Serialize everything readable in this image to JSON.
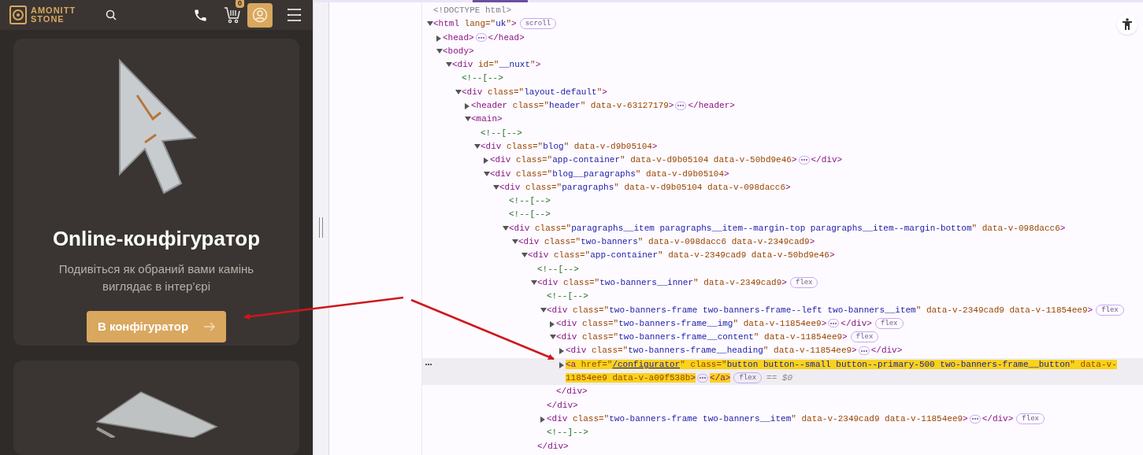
{
  "site": {
    "logo_text": [
      "AMONITT",
      "STONE"
    ],
    "cart_count": "0",
    "card": {
      "title": "Online-конфігуратор",
      "description": "Подивіться як обраний вами камінь виглядає в інтер’єрі",
      "button": "В конфігуратор"
    }
  },
  "elements_tree": [
    {
      "tokens": [
        {
          "kind": "d",
          "text": "<!DOCTYPE html>"
        }
      ],
      "selected": false
    },
    {
      "tokens": [
        {
          "kind": "t",
          "text": "<html"
        },
        {
          "kind": "a",
          "text": " lang=\""
        },
        {
          "kind": "v",
          "text": "uk"
        },
        {
          "kind": "a",
          "text": "\""
        },
        {
          "kind": "t",
          "text": ">"
        },
        {
          "kind": "b",
          "text": "scroll"
        }
      ],
      "expanded": true,
      "selected": false,
      "children": [
        {
          "tokens": [
            {
              "kind": "t",
              "text": "<head>"
            },
            {
              "kind": "m"
            },
            {
              "kind": "t",
              "text": "</head>"
            }
          ],
          "expanded": false,
          "selected": false
        },
        {
          "tokens": [
            {
              "kind": "t",
              "text": "<body>"
            }
          ],
          "expanded": true,
          "selected": false,
          "children": [
            {
              "tokens": [
                {
                  "kind": "t",
                  "text": "<div"
                },
                {
                  "kind": "a",
                  "text": " id=\""
                },
                {
                  "kind": "v",
                  "text": "__nuxt"
                },
                {
                  "kind": "a",
                  "text": "\""
                },
                {
                  "kind": "t",
                  "text": ">"
                }
              ],
              "expanded": true,
              "selected": false,
              "children": [
                {
                  "tokens": [
                    {
                      "kind": "c",
                      "text": "<!--[-->"
                    }
                  ],
                  "selected": false
                },
                {
                  "tokens": [
                    {
                      "kind": "t",
                      "text": "<div"
                    },
                    {
                      "kind": "a",
                      "text": " class=\""
                    },
                    {
                      "kind": "v",
                      "text": "layout-default"
                    },
                    {
                      "kind": "a",
                      "text": "\""
                    },
                    {
                      "kind": "t",
                      "text": ">"
                    }
                  ],
                  "expanded": true,
                  "selected": false,
                  "children": [
                    {
                      "tokens": [
                        {
                          "kind": "t",
                          "text": "<header"
                        },
                        {
                          "kind": "a",
                          "text": " class=\""
                        },
                        {
                          "kind": "v",
                          "text": "header"
                        },
                        {
                          "kind": "a",
                          "text": "\" data-v-63127179"
                        },
                        {
                          "kind": "t",
                          "text": ">"
                        },
                        {
                          "kind": "m"
                        },
                        {
                          "kind": "t",
                          "text": "</header>"
                        }
                      ],
                      "expanded": false,
                      "selected": false
                    },
                    {
                      "tokens": [
                        {
                          "kind": "t",
                          "text": "<main>"
                        }
                      ],
                      "expanded": true,
                      "selected": false,
                      "children": [
                        {
                          "tokens": [
                            {
                              "kind": "c",
                              "text": "<!--[-->"
                            }
                          ],
                          "selected": false
                        },
                        {
                          "tokens": [
                            {
                              "kind": "t",
                              "text": "<div"
                            },
                            {
                              "kind": "a",
                              "text": " class=\""
                            },
                            {
                              "kind": "v",
                              "text": "blog"
                            },
                            {
                              "kind": "a",
                              "text": "\" data-v-d9b05104"
                            },
                            {
                              "kind": "t",
                              "text": ">"
                            }
                          ],
                          "expanded": true,
                          "selected": false,
                          "children": [
                            {
                              "tokens": [
                                {
                                  "kind": "t",
                                  "text": "<div"
                                },
                                {
                                  "kind": "a",
                                  "text": " class=\""
                                },
                                {
                                  "kind": "v",
                                  "text": "app-container"
                                },
                                {
                                  "kind": "a",
                                  "text": "\" data-v-d9b05104 data-v-50bd9e46"
                                },
                                {
                                  "kind": "t",
                                  "text": ">"
                                },
                                {
                                  "kind": "m"
                                },
                                {
                                  "kind": "t",
                                  "text": "</div>"
                                }
                              ],
                              "expanded": false,
                              "selected": false
                            },
                            {
                              "tokens": [
                                {
                                  "kind": "t",
                                  "text": "<div"
                                },
                                {
                                  "kind": "a",
                                  "text": " class=\""
                                },
                                {
                                  "kind": "v",
                                  "text": "blog__paragraphs"
                                },
                                {
                                  "kind": "a",
                                  "text": "\" data-v-d9b05104"
                                },
                                {
                                  "kind": "t",
                                  "text": ">"
                                }
                              ],
                              "expanded": true,
                              "selected": false,
                              "children": [
                                {
                                  "tokens": [
                                    {
                                      "kind": "t",
                                      "text": "<div"
                                    },
                                    {
                                      "kind": "a",
                                      "text": " class=\""
                                    },
                                    {
                                      "kind": "v",
                                      "text": "paragraphs"
                                    },
                                    {
                                      "kind": "a",
                                      "text": "\" data-v-d9b05104 data-v-098dacc6"
                                    },
                                    {
                                      "kind": "t",
                                      "text": ">"
                                    }
                                  ],
                                  "expanded": true,
                                  "selected": false,
                                  "children": [
                                    {
                                      "tokens": [
                                        {
                                          "kind": "c",
                                          "text": "<!--[-->"
                                        }
                                      ],
                                      "selected": false
                                    },
                                    {
                                      "tokens": [
                                        {
                                          "kind": "c",
                                          "text": "<!--[-->"
                                        }
                                      ],
                                      "selected": false
                                    },
                                    {
                                      "tokens": [
                                        {
                                          "kind": "t",
                                          "text": "<div"
                                        },
                                        {
                                          "kind": "a",
                                          "text": " class=\""
                                        },
                                        {
                                          "kind": "v",
                                          "text": "paragraphs__item paragraphs__item--margin-top paragraphs__item--margin-bottom"
                                        },
                                        {
                                          "kind": "a",
                                          "text": "\" data-v-098dacc6"
                                        },
                                        {
                                          "kind": "t",
                                          "text": ">"
                                        }
                                      ],
                                      "expanded": true,
                                      "selected": false,
                                      "children": [
                                        {
                                          "tokens": [
                                            {
                                              "kind": "t",
                                              "text": "<div"
                                            },
                                            {
                                              "kind": "a",
                                              "text": " class=\""
                                            },
                                            {
                                              "kind": "v",
                                              "text": "two-banners"
                                            },
                                            {
                                              "kind": "a",
                                              "text": "\" data-v-098dacc6 data-v-2349cad9"
                                            },
                                            {
                                              "kind": "t",
                                              "text": ">"
                                            }
                                          ],
                                          "expanded": true,
                                          "selected": false,
                                          "children": [
                                            {
                                              "tokens": [
                                                {
                                                  "kind": "t",
                                                  "text": "<div"
                                                },
                                                {
                                                  "kind": "a",
                                                  "text": " class=\""
                                                },
                                                {
                                                  "kind": "v",
                                                  "text": "app-container"
                                                },
                                                {
                                                  "kind": "a",
                                                  "text": "\" data-v-2349cad9 data-v-50bd9e46"
                                                },
                                                {
                                                  "kind": "t",
                                                  "text": ">"
                                                }
                                              ],
                                              "expanded": true,
                                              "selected": false,
                                              "children": [
                                                {
                                                  "tokens": [
                                                    {
                                                      "kind": "c",
                                                      "text": "<!--[-->"
                                                    }
                                                  ],
                                                  "selected": false
                                                },
                                                {
                                                  "tokens": [
                                                    {
                                                      "kind": "t",
                                                      "text": "<div"
                                                    },
                                                    {
                                                      "kind": "a",
                                                      "text": " class=\""
                                                    },
                                                    {
                                                      "kind": "v",
                                                      "text": "two-banners__inner"
                                                    },
                                                    {
                                                      "kind": "a",
                                                      "text": "\" data-v-2349cad9"
                                                    },
                                                    {
                                                      "kind": "t",
                                                      "text": ">"
                                                    },
                                                    {
                                                      "kind": "b",
                                                      "text": "flex"
                                                    }
                                                  ],
                                                  "expanded": true,
                                                  "selected": false,
                                                  "closing": [
                                                    {
                                                      "kind": "t",
                                                      "text": "</div>"
                                                    }
                                                  ],
                                                  "children": [
                                                    {
                                                      "tokens": [
                                                        {
                                                          "kind": "c",
                                                          "text": "<!--[-->"
                                                        }
                                                      ],
                                                      "selected": false
                                                    },
                                                    {
                                                      "tokens": [
                                                        {
                                                          "kind": "t",
                                                          "text": "<div"
                                                        },
                                                        {
                                                          "kind": "a",
                                                          "text": " class=\""
                                                        },
                                                        {
                                                          "kind": "v",
                                                          "text": "two-banners-frame two-banners-frame--left two-banners__item"
                                                        },
                                                        {
                                                          "kind": "a",
                                                          "text": "\" data-v-2349cad9 data-v-11854ee9"
                                                        },
                                                        {
                                                          "kind": "t",
                                                          "text": ">"
                                                        },
                                                        {
                                                          "kind": "b",
                                                          "text": "flex"
                                                        }
                                                      ],
                                                      "expanded": true,
                                                      "selected": false,
                                                      "closing": [
                                                        {
                                                          "kind": "t",
                                                          "text": "</div>"
                                                        }
                                                      ],
                                                      "children": [
                                                        {
                                                          "tokens": [
                                                            {
                                                              "kind": "t",
                                                              "text": "<div"
                                                            },
                                                            {
                                                              "kind": "a",
                                                              "text": " class=\""
                                                            },
                                                            {
                                                              "kind": "v",
                                                              "text": "two-banners-frame__img"
                                                            },
                                                            {
                                                              "kind": "a",
                                                              "text": "\" data-v-11854ee9"
                                                            },
                                                            {
                                                              "kind": "t",
                                                              "text": ">"
                                                            },
                                                            {
                                                              "kind": "m"
                                                            },
                                                            {
                                                              "kind": "t",
                                                              "text": "</div>"
                                                            },
                                                            {
                                                              "kind": "b",
                                                              "text": "flex"
                                                            }
                                                          ],
                                                          "expanded": false,
                                                          "selected": false
                                                        },
                                                        {
                                                          "tokens": [
                                                            {
                                                              "kind": "t",
                                                              "text": "<div"
                                                            },
                                                            {
                                                              "kind": "a",
                                                              "text": " class=\""
                                                            },
                                                            {
                                                              "kind": "v",
                                                              "text": "two-banners-frame__content"
                                                            },
                                                            {
                                                              "kind": "a",
                                                              "text": "\" data-v-11854ee9"
                                                            },
                                                            {
                                                              "kind": "t",
                                                              "text": ">"
                                                            },
                                                            {
                                                              "kind": "b",
                                                              "text": "flex"
                                                            }
                                                          ],
                                                          "expanded": true,
                                                          "selected": false,
                                                          "closing": [
                                                            {
                                                              "kind": "t",
                                                              "text": "</div>"
                                                            }
                                                          ],
                                                          "children": [
                                                            {
                                                              "tokens": [
                                                                {
                                                                  "kind": "t",
                                                                  "text": "<div"
                                                                },
                                                                {
                                                                  "kind": "a",
                                                                  "text": " class=\""
                                                                },
                                                                {
                                                                  "kind": "v",
                                                                  "text": "two-banners-frame__heading"
                                                                },
                                                                {
                                                                  "kind": "a",
                                                                  "text": "\" data-v-11854ee9"
                                                                },
                                                                {
                                                                  "kind": "t",
                                                                  "text": ">"
                                                                },
                                                                {
                                                                  "kind": "m"
                                                                },
                                                                {
                                                                  "kind": "t",
                                                                  "text": "</div>"
                                                                }
                                                              ],
                                                              "expanded": false,
                                                              "selected": false
                                                            },
                                                            {
                                                              "tokens": [
                                                                {
                                                                  "kind": "t",
                                                                  "text": "<a"
                                                                },
                                                                {
                                                                  "kind": "a",
                                                                  "text": " href=\""
                                                                },
                                                                {
                                                                  "kind": "l",
                                                                  "text": "/configurator"
                                                                },
                                                                {
                                                                  "kind": "a",
                                                                  "text": "\" class=\""
                                                                },
                                                                {
                                                                  "kind": "v",
                                                                  "text": "button button--small button--primary-500 two-banners-frame__button"
                                                                },
                                                                {
                                                                  "kind": "a",
                                                                  "text": "\" data-v-11854ee9 data-v-a09f538b"
                                                                },
                                                                {
                                                                  "kind": "t",
                                                                  "text": ">"
                                                                },
                                                                {
                                                                  "kind": "m"
                                                                },
                                                                {
                                                                  "kind": "t",
                                                                  "text": "</a>"
                                                                },
                                                                {
                                                                  "kind": "b",
                                                                  "text": "flex"
                                                                },
                                                                {
                                                                  "kind": "h",
                                                                  "text": "== $0"
                                                                }
                                                              ],
                                                              "expanded": false,
                                                              "selected": true
                                                            }
                                                          ]
                                                        }
                                                      ]
                                                    },
                                                    {
                                                      "tokens": [
                                                        {
                                                          "kind": "t",
                                                          "text": "<div"
                                                        },
                                                        {
                                                          "kind": "a",
                                                          "text": " class=\""
                                                        },
                                                        {
                                                          "kind": "v",
                                                          "text": "two-banners-frame two-banners__item"
                                                        },
                                                        {
                                                          "kind": "a",
                                                          "text": "\" data-v-2349cad9 data-v-11854ee9"
                                                        },
                                                        {
                                                          "kind": "t",
                                                          "text": ">"
                                                        },
                                                        {
                                                          "kind": "m"
                                                        },
                                                        {
                                                          "kind": "t",
                                                          "text": "</div>"
                                                        },
                                                        {
                                                          "kind": "b",
                                                          "text": "flex"
                                                        }
                                                      ],
                                                      "expanded": false,
                                                      "selected": false
                                                    },
                                                    {
                                                      "tokens": [
                                                        {
                                                          "kind": "c",
                                                          "text": "<!--]-->"
                                                        }
                                                      ],
                                                      "selected": false
                                                    }
                                                  ]
                                                }
                                              ]
                                            }
                                          ]
                                        }
                                      ]
                                    }
                                  ]
                                }
                              ]
                            }
                          ]
                        }
                      ]
                    }
                  ]
                }
              ]
            }
          ]
        }
      ]
    }
  ]
}
